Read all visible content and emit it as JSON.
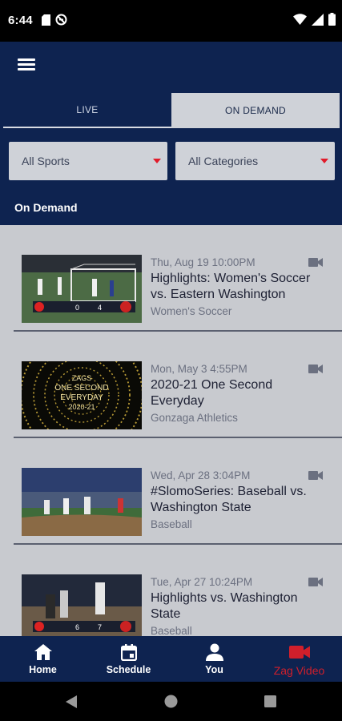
{
  "status_bar": {
    "time": "6:44",
    "left_icons": [
      "sd-card-icon",
      "blocked-icon"
    ],
    "right_icons": [
      "wifi-icon",
      "signal-icon",
      "battery-icon"
    ]
  },
  "header": {
    "menu_icon": "hamburger-menu-icon",
    "tabs": [
      {
        "label": "LIVE",
        "active": false
      },
      {
        "label": "ON DEMAND",
        "active": true
      }
    ],
    "filters": {
      "sports": "All Sports",
      "categories": "All Categories"
    },
    "section_title": "On Demand"
  },
  "videos": [
    {
      "date": "Thu, Aug 19 10:00PM",
      "title": "Highlights: Women's Soccer vs. Eastern Washington",
      "category": "Women's Soccer",
      "icon": "video-camera-icon"
    },
    {
      "date": "Mon, May 3 4:55PM",
      "title": "2020-21 One Second Everyday",
      "category": "Gonzaga Athletics",
      "icon": "video-camera-icon"
    },
    {
      "date": "Wed, Apr 28 3:04PM",
      "title": "#SlomoSeries: Baseball vs. Washington State",
      "category": "Baseball",
      "icon": "video-camera-icon"
    },
    {
      "date": "Tue, Apr 27 10:24PM",
      "title": "Highlights vs. Washington State",
      "category": "Baseball",
      "icon": "video-camera-icon"
    }
  ],
  "thumbs": {
    "soccer_score_left": "0",
    "soccer_score_right": "4",
    "ose_line1": "ZAGS",
    "ose_line2": "ONE SECOND",
    "ose_line3": "EVERYDAY",
    "ose_line4": "2020-21",
    "baseball_score_left": "6",
    "baseball_score_right": "7"
  },
  "bottom_nav": [
    {
      "label": "Home",
      "icon": "home-icon",
      "active": false
    },
    {
      "label": "Schedule",
      "icon": "calendar-icon",
      "active": false
    },
    {
      "label": "You",
      "icon": "person-icon",
      "active": false
    },
    {
      "label": "Zag Video",
      "icon": "video-camera-icon",
      "active": true
    }
  ],
  "colors": {
    "header_bg": "#0e2350",
    "content_bg": "#c8cacf",
    "accent_red": "#d11f2b"
  }
}
